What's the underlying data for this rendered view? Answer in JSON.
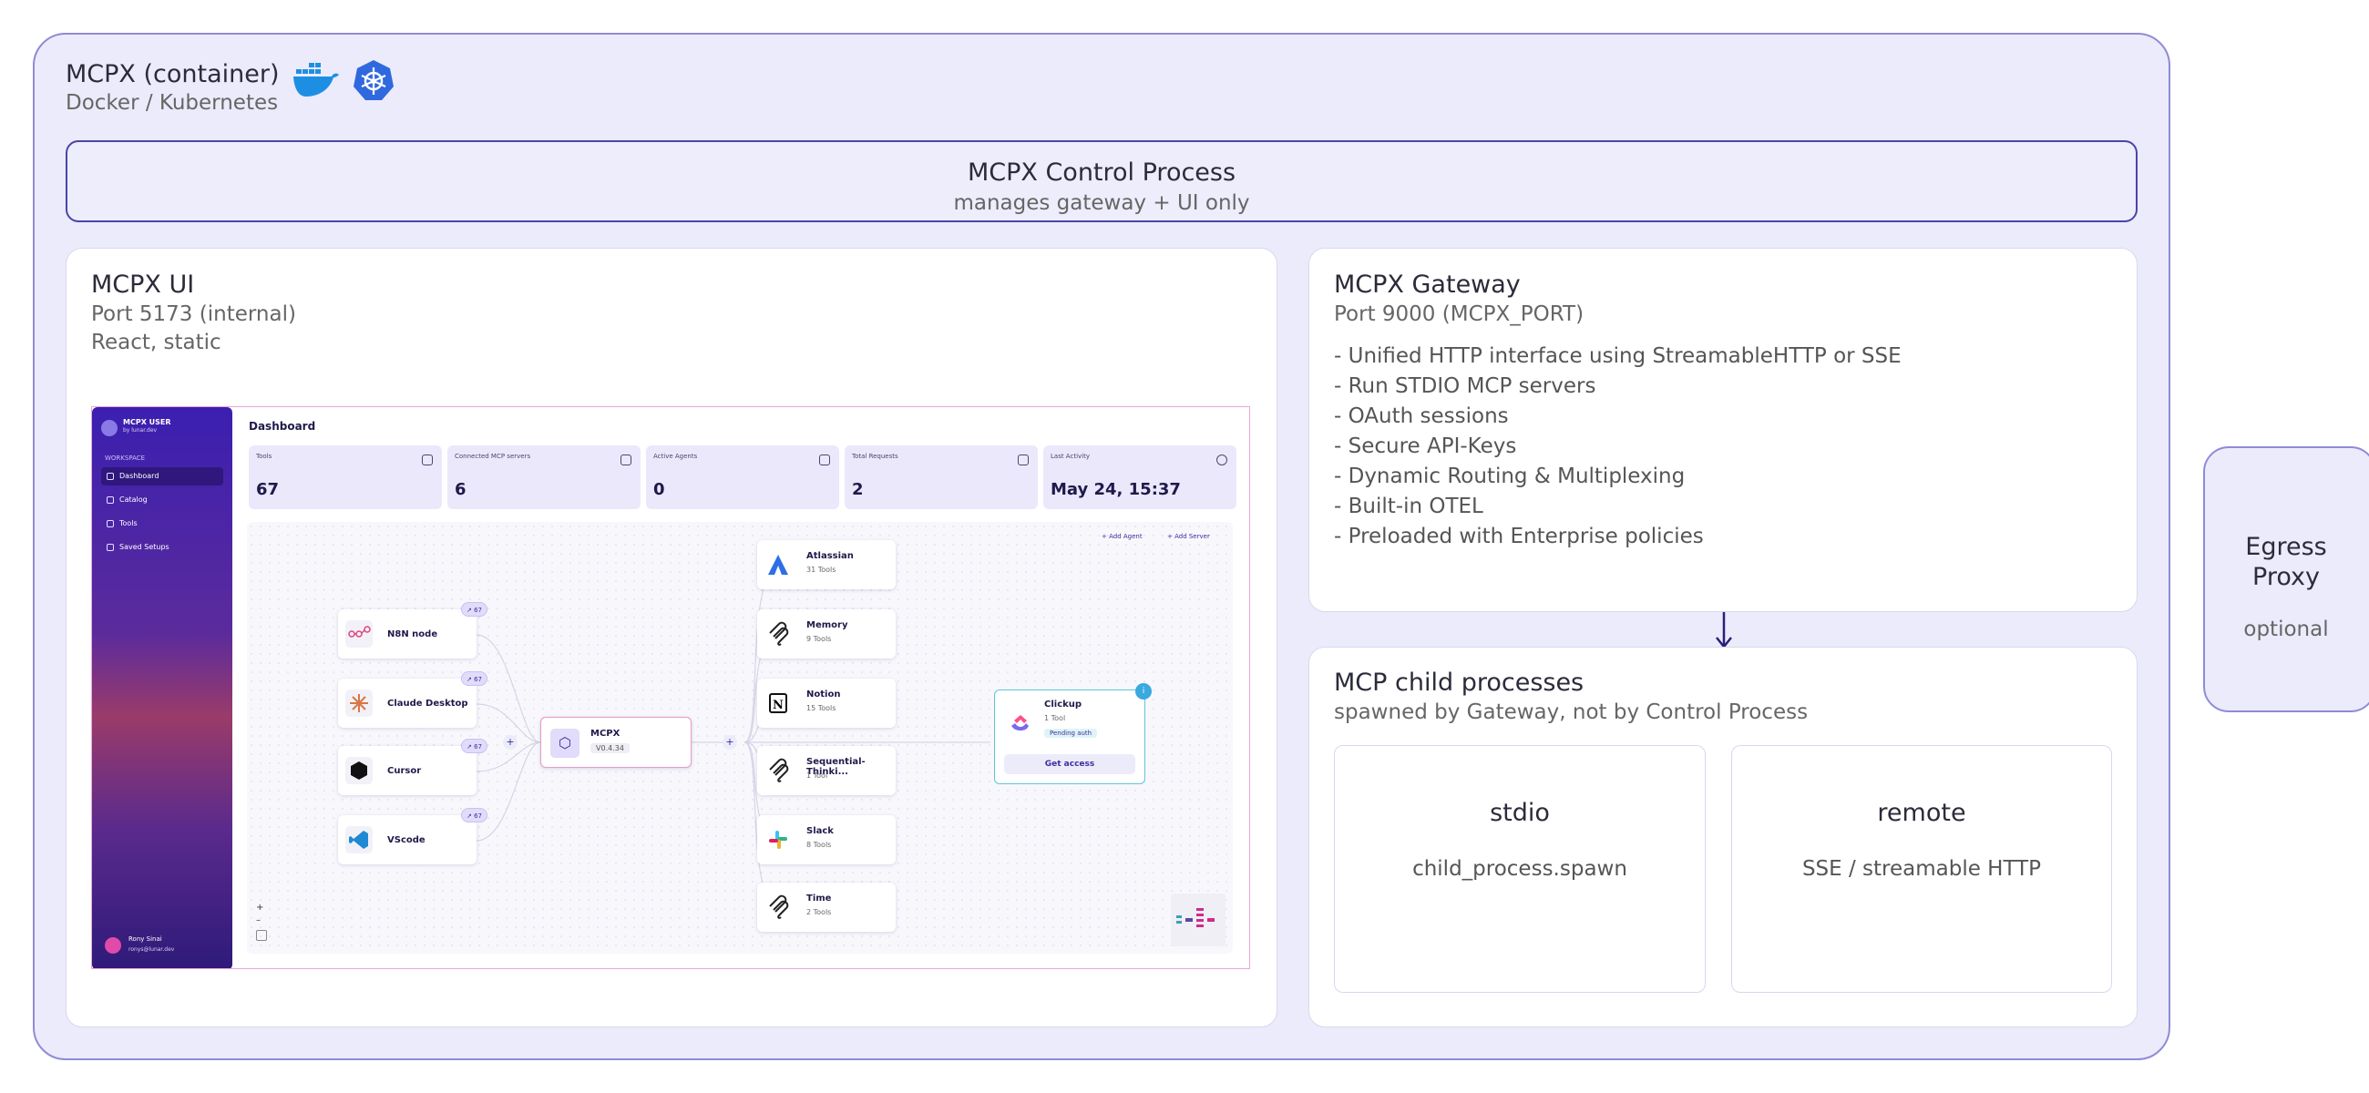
{
  "container": {
    "title": "MCPX (container)",
    "subtitle": "Docker / Kubernetes",
    "icons": [
      "docker-icon",
      "kubernetes-icon"
    ]
  },
  "control_process": {
    "title": "MCPX Control Process",
    "subtitle": "manages gateway + UI only"
  },
  "ui_panel": {
    "title": "MCPX UI",
    "port": "Port 5173 (internal)",
    "stack": "React, static"
  },
  "gateway": {
    "title": "MCPX Gateway",
    "port": "Port 9000 (MCPX_PORT)",
    "features": [
      "- Unified HTTP interface using StreamableHTTP or SSE",
      "- Run STDIO MCP servers",
      "- OAuth sessions",
      "- Secure API-Keys",
      "- Dynamic Routing & Multiplexing",
      "- Built-in OTEL",
      "- Preloaded with Enterprise policies"
    ]
  },
  "child_processes": {
    "title": "MCP child processes",
    "subtitle": "spawned by Gateway, not by Control Process",
    "stdio": {
      "title": "stdio",
      "detail": "child_process.spawn"
    },
    "remote": {
      "title": "remote",
      "detail": "SSE / streamable HTTP"
    }
  },
  "egress": {
    "title_line1": "Egress",
    "title_line2": "Proxy",
    "note": "optional"
  },
  "dashboard": {
    "brand": "MCPX USER",
    "brand_by": "by lunar.dev",
    "workspace": "WORKSPACE",
    "nav": [
      "Dashboard",
      "Catalog",
      "Tools",
      "Saved Setups"
    ],
    "user_name": "Rony Sinai",
    "user_email": "ronys@lunar.dev",
    "title": "Dashboard",
    "stats": [
      {
        "label": "Tools",
        "value": "67"
      },
      {
        "label": "Connected MCP servers",
        "value": "6"
      },
      {
        "label": "Active Agents",
        "value": "0"
      },
      {
        "label": "Total Requests",
        "value": "2"
      },
      {
        "label": "Last Activity",
        "value": "May 24, 15:37"
      }
    ],
    "add_agent": "+ Add Agent",
    "add_server": "+ Add Server",
    "agents": [
      {
        "name": "N8N node",
        "badge": "↗ 67"
      },
      {
        "name": "Claude Desktop",
        "badge": "↗ 67"
      },
      {
        "name": "Cursor",
        "badge": "↗ 67"
      },
      {
        "name": "VScode",
        "badge": "↗ 67"
      }
    ],
    "hub": {
      "name": "MCPX",
      "version": "V0.4.34"
    },
    "servers": [
      {
        "name": "Atlassian",
        "tools": "31 Tools"
      },
      {
        "name": "Memory",
        "tools": "9 Tools"
      },
      {
        "name": "Notion",
        "tools": "15 Tools"
      },
      {
        "name": "Sequential-Thinki...",
        "tools": "1 Tool"
      },
      {
        "name": "Slack",
        "tools": "8 Tools"
      },
      {
        "name": "Time",
        "tools": "2 Tools"
      }
    ],
    "pending": {
      "name": "Clickup",
      "tools": "1 Tool",
      "status": "Pending auth",
      "button": "Get access"
    },
    "zoom_in": "+",
    "zoom_out": "–"
  },
  "colors": {
    "container_bg": "#ecebfb",
    "container_border": "#8f8bd6",
    "control_border": "#4b44a8",
    "arrow": "#2a1f7a"
  }
}
